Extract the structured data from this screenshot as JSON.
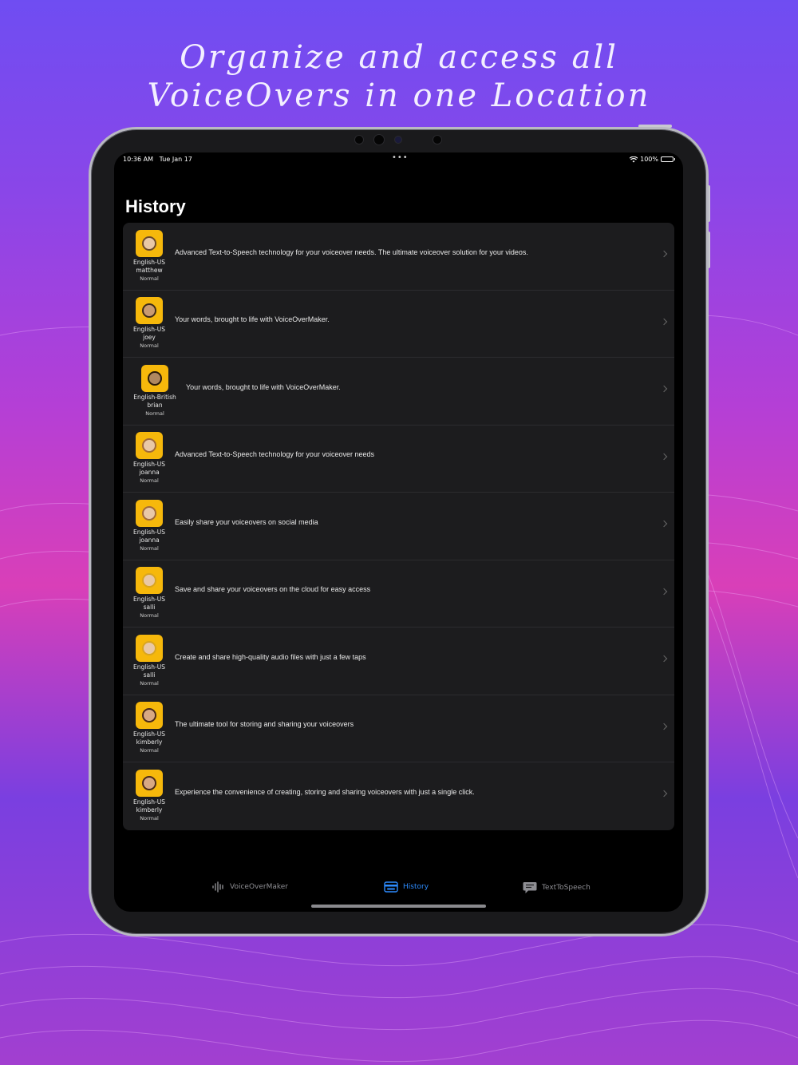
{
  "headline": {
    "line1": "Organize and access all",
    "line2": "VoiceOvers in one Location"
  },
  "status_bar": {
    "time": "10:36 AM",
    "date": "Tue Jan 17",
    "dots": "•••",
    "battery": "100%"
  },
  "page_title": "History",
  "history": [
    {
      "language": "English-US",
      "voice": "matthew",
      "style": "Normal",
      "text": "Advanced Text-to-Speech technology for your voiceover needs. The ultimate voiceover solution for your videos."
    },
    {
      "language": "English-US",
      "voice": "joey",
      "style": "Normal",
      "text": "Your words, brought to life with VoiceOverMaker."
    },
    {
      "language": "English-British",
      "voice": "brian",
      "style": "Normal",
      "text": "Your words, brought to life with VoiceOverMaker."
    },
    {
      "language": "English-US",
      "voice": "joanna",
      "style": "Normal",
      "text": "Advanced Text-to-Speech technology for your voiceover needs"
    },
    {
      "language": "English-US",
      "voice": "joanna",
      "style": "Normal",
      "text": "Easily share your voiceovers on social media"
    },
    {
      "language": "English-US",
      "voice": "salli",
      "style": "Normal",
      "text": "Save and share your voiceovers on the cloud for easy access"
    },
    {
      "language": "English-US",
      "voice": "salli",
      "style": "Normal",
      "text": "Create and share high-quality audio files with just a few taps"
    },
    {
      "language": "English-US",
      "voice": "kimberly",
      "style": "Normal",
      "text": "The ultimate tool for storing and sharing your voiceovers"
    },
    {
      "language": "English-US",
      "voice": "kimberly",
      "style": "Normal",
      "text": "Experience the convenience of creating, storing and sharing voiceovers with just a single click."
    }
  ],
  "tabs": {
    "voiceovermaker": {
      "label": "VoiceOverMaker",
      "icon": "waveform-icon"
    },
    "history": {
      "label": "History",
      "icon": "card-icon"
    },
    "texttospeech": {
      "label": "TextToSpeech",
      "icon": "speech-bubble-icon"
    }
  },
  "colors": {
    "accent": "#2d8cff",
    "avatar_bg": "#f6b80b"
  }
}
